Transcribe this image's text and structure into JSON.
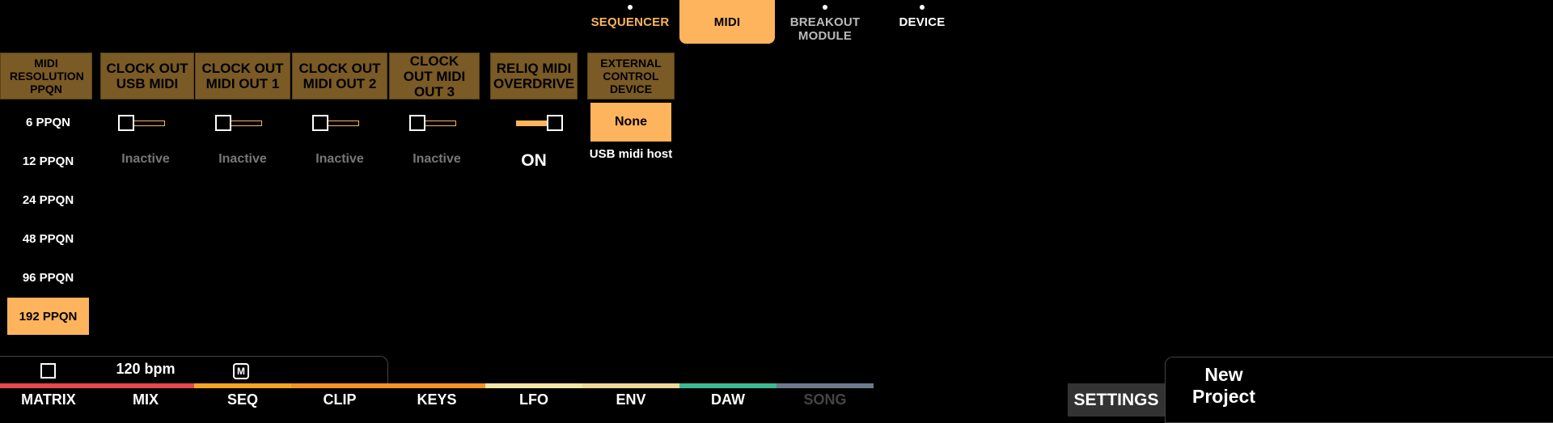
{
  "top_tabs": [
    {
      "label": "SEQUENCER"
    },
    {
      "label": "MIDI"
    },
    {
      "label": "BREAKOUT MODULE"
    },
    {
      "label": "DEVICE"
    }
  ],
  "headers": {
    "midi_resolution": "MIDI RESOLUTION PPQN",
    "clock_usb": "CLOCK OUT USB MIDI",
    "clock_out1": "CLOCK OUT MIDI OUT 1",
    "clock_out2": "CLOCK OUT MIDI OUT 2",
    "clock_out3": "CLOCK OUT MIDI OUT 3",
    "overdrive": "RELIQ MIDI OVERDRIVE",
    "ext_control": "EXTERNAL CONTROL DEVICE"
  },
  "ppqn_options": [
    "6 PPQN",
    "12 PPQN",
    "24 PPQN",
    "48 PPQN",
    "96 PPQN",
    "192 PPQN"
  ],
  "ppqn_selected": "192 PPQN",
  "clock_status": {
    "usb": "Inactive",
    "out1": "Inactive",
    "out2": "Inactive",
    "out3": "Inactive",
    "overdrive": "ON"
  },
  "ext_control": {
    "button": "None",
    "caption": "USB midi host"
  },
  "transport": {
    "bpm": "120 bpm",
    "metronome": "M"
  },
  "bottom_tabs": [
    {
      "label": "MATRIX",
      "color": "#e5484d"
    },
    {
      "label": "MIX",
      "color": "#e5484d"
    },
    {
      "label": "SEQ",
      "color": "#f5a524"
    },
    {
      "label": "CLIP",
      "color": "#f59324"
    },
    {
      "label": "KEYS",
      "color": "#f59324"
    },
    {
      "label": "LFO",
      "color": "#f3e6a8"
    },
    {
      "label": "ENV",
      "color": "#f0d998"
    },
    {
      "label": "DAW",
      "color": "#3cba92"
    },
    {
      "label": "SONG",
      "color": "#6b7b8c"
    }
  ],
  "settings_label": "SETTINGS",
  "project_name": "New Project",
  "colors": {
    "accent": "#fdb45c",
    "header_bg": "#7a5a25"
  }
}
